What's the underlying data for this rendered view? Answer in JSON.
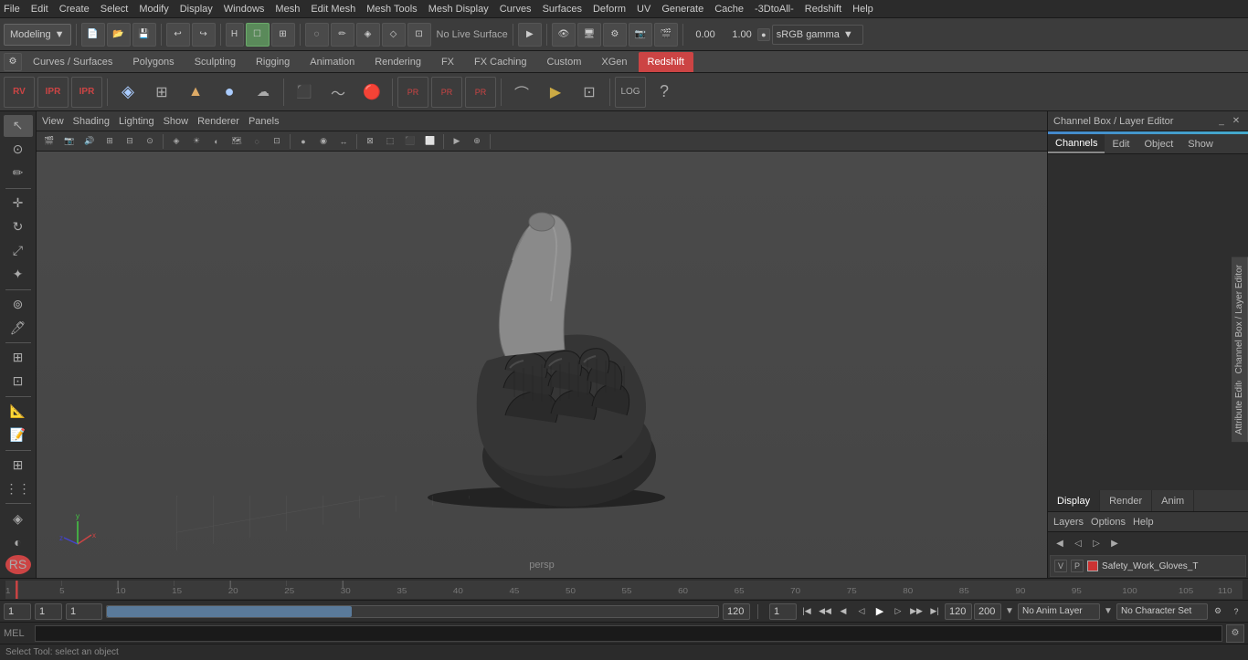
{
  "menubar": {
    "items": [
      "File",
      "Edit",
      "Create",
      "Select",
      "Modify",
      "Display",
      "Windows",
      "Mesh",
      "Edit Mesh",
      "Mesh Tools",
      "Mesh Display",
      "Curves",
      "Surfaces",
      "Deform",
      "UV",
      "Generate",
      "Cache",
      "-3DtoAll-",
      "Redshift",
      "Help"
    ]
  },
  "toolbar": {
    "workspace": "Modeling",
    "gamma_value": "sRGB gamma",
    "translate_value": "0.00",
    "scale_value": "1.00"
  },
  "tabs": {
    "items": [
      "Curves / Surfaces",
      "Polygons",
      "Sculpting",
      "Rigging",
      "Animation",
      "Rendering",
      "FX",
      "FX Caching",
      "Custom",
      "XGen",
      "Redshift"
    ]
  },
  "viewport": {
    "menus": [
      "View",
      "Shading",
      "Lighting",
      "Show",
      "Renderer",
      "Panels"
    ],
    "camera": "persp"
  },
  "right_panel": {
    "title": "Channel Box / Layer Editor",
    "channel_tabs": [
      "Channels",
      "Edit",
      "Object",
      "Show"
    ],
    "display_tabs": [
      "Display",
      "Render",
      "Anim"
    ],
    "active_display_tab": "Display",
    "layers_label": "Layers",
    "layers_menu": [
      "Layers",
      "Options",
      "Help"
    ],
    "layer_name": "Safety_Work_Gloves_T"
  },
  "timeline": {
    "start": "1",
    "end": "120",
    "current": "1",
    "playback_start": "1",
    "playback_end": "120",
    "range_end": "200"
  },
  "bottom_bar": {
    "field1": "1",
    "field2": "1",
    "field3": "1",
    "anim_layer": "No Anim Layer",
    "char_set": "No Character Set"
  },
  "command_line": {
    "label": "MEL",
    "placeholder": ""
  },
  "status_bar": {
    "text": "Select Tool: select an object"
  },
  "icons": {
    "select": "↖",
    "transform": "⊕",
    "rotate": "↻",
    "scale": "⤢",
    "universal": "✦",
    "lasso": "◌",
    "paint": "✏",
    "zoom": "⊞",
    "grid": "⊞",
    "separator": "|"
  }
}
